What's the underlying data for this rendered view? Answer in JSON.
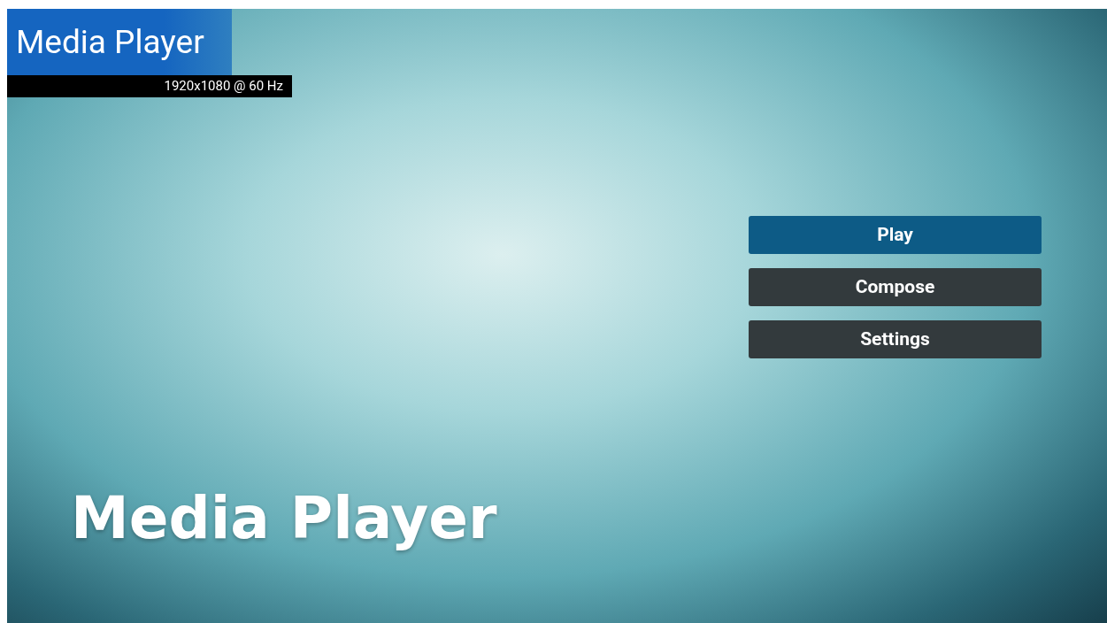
{
  "app": {
    "title": "Media Player",
    "display_mode": "1920x1080 @ 60 Hz"
  },
  "menu": [
    {
      "label": "Play",
      "selected": true
    },
    {
      "label": "Compose",
      "selected": false
    },
    {
      "label": "Settings",
      "selected": false
    }
  ],
  "banner": {
    "text": "Media Player"
  }
}
